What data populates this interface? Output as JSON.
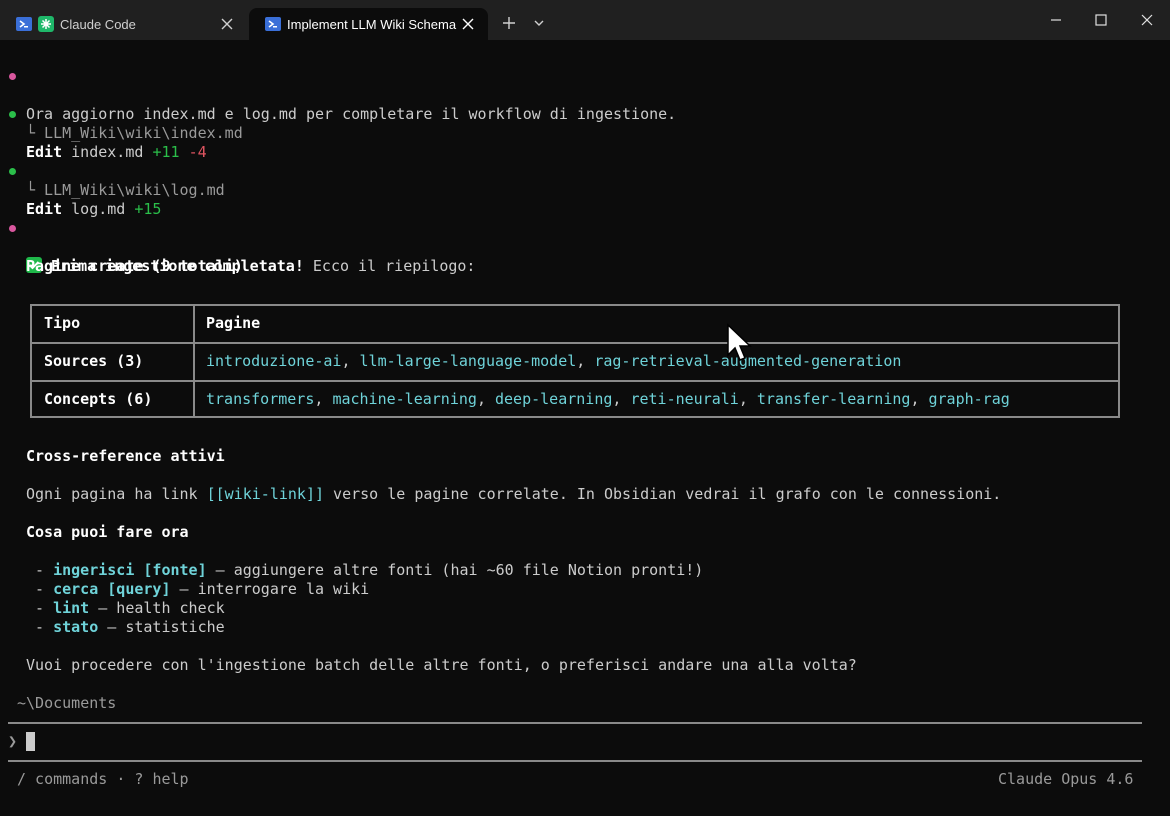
{
  "window": {
    "tabs": [
      {
        "label": "Claude Code",
        "icon": "powershell-icon",
        "active": false
      },
      {
        "label": "Implement LLM Wiki Schema",
        "icon": "powershell-icon",
        "active": true
      }
    ]
  },
  "terminal": {
    "line1": "Ora aggiorno index.md e log.md per completare il workflow di ingestione.",
    "edit1": {
      "verb": "Edit",
      "file": "index.md",
      "added": "+11",
      "removed": "-4",
      "path": "└ LLM_Wiki\\wiki\\index.md"
    },
    "edit2": {
      "verb": "Edit",
      "file": "log.md",
      "added": "+15",
      "path": "└ LLM_Wiki\\wiki\\log.md"
    },
    "summary": {
      "bold": "Prima ingestione completata!",
      "rest": " Ecco il riepilogo:"
    },
    "pages_heading": "Pagine create (9 totali)",
    "table": {
      "headers": [
        "Tipo",
        "Pagine"
      ],
      "rows": [
        {
          "tipo": "Sources (3)",
          "pagine": [
            "introduzione-ai",
            "llm-large-language-model",
            "rag-retrieval-augmented-generation"
          ]
        },
        {
          "tipo": "Concepts (6)",
          "pagine": [
            "transformers",
            "machine-learning",
            "deep-learning",
            "reti-neurali",
            "transfer-learning",
            "graph-rag"
          ]
        }
      ],
      "separator": ", "
    },
    "crossref_heading": "Cross-reference attivi",
    "crossref_text": {
      "before": "Ogni pagina ha link ",
      "link": "[[wiki-link]]",
      "after": " verso le pagine correlate. In Obsidian vedrai il grafo con le connessioni."
    },
    "actions_heading": "Cosa puoi fare ora",
    "actions": [
      {
        "cmd": "ingerisci [fonte]",
        "desc": " — aggiungere altre fonti (hai ~60 file Notion pronti!)"
      },
      {
        "cmd": "cerca [query]",
        "desc": " — interrogare la wiki"
      },
      {
        "cmd": "lint",
        "desc": " — health check"
      },
      {
        "cmd": "stato",
        "desc": " — statistiche"
      }
    ],
    "bullet": " - ",
    "question": "Vuoi procedere con l'ingestione batch delle altre fonti, o preferisci andare una alla volta?",
    "cwd": "~\\Documents",
    "prompt_symbol": "❯",
    "footer_left": "/ commands · ? help",
    "footer_right": "Claude Opus 4.6"
  },
  "colors": {
    "accent_cyan": "#6fd3d9",
    "added_green": "#2bbf4a",
    "removed_red": "#e05561",
    "bullet_pink": "#d9579e"
  }
}
